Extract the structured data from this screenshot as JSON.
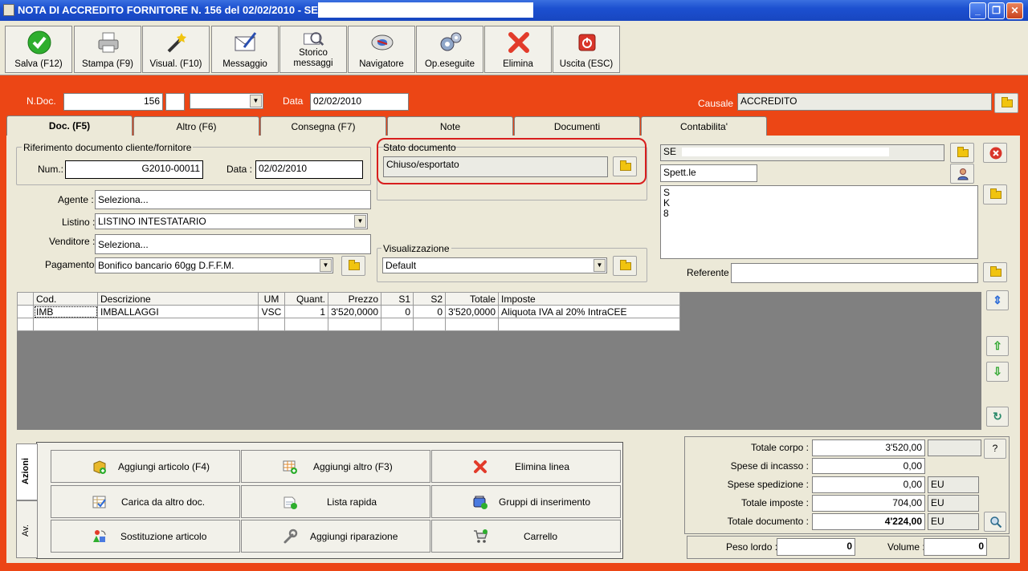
{
  "window": {
    "title": "NOTA DI ACCREDITO FORNITORE N. 156  del 02/02/2010 - SE",
    "minimize": "_",
    "maximize": "❐",
    "close": "✕"
  },
  "toolbar": [
    {
      "label": "Salva (F12)",
      "icon": "check-icon"
    },
    {
      "label": "Stampa (F9)",
      "icon": "printer-icon"
    },
    {
      "label": "Visual. (F10)",
      "icon": "magic-wand-icon"
    },
    {
      "label": "Messaggio",
      "icon": "envelope-pen-icon"
    },
    {
      "label": "Storico messaggi",
      "icon": "mail-history-icon"
    },
    {
      "label": "Navigatore",
      "icon": "navigator-icon"
    },
    {
      "label": "Op.eseguite",
      "icon": "gears-icon"
    },
    {
      "label": "Elimina",
      "icon": "red-x-icon"
    },
    {
      "label": "Uscita (ESC)",
      "icon": "exit-icon"
    }
  ],
  "header": {
    "ndoc_label": "N.Doc.",
    "ndoc_value": "156",
    "data_label": "Data",
    "data_value": "02/02/2010",
    "causale_label": "Causale",
    "causale_value": "ACCREDITO"
  },
  "tabs": [
    "Doc. (F5)",
    "Altro (F6)",
    "Consegna (F7)",
    "Note",
    "Documenti",
    "Contabilita'"
  ],
  "riferimento": {
    "title": "Riferimento documento cliente/fornitore",
    "num_label": "Num.:",
    "num_value": "G2010-00011",
    "data_label": "Data :",
    "data_value": "02/02/2010"
  },
  "stato": {
    "title": "Stato documento",
    "value": "Chiuso/esportato"
  },
  "fields": {
    "agente_label": "Agente :",
    "agente_value": "Seleziona...",
    "listino_label": "Listino :",
    "listino_value": "LISTINO INTESTATARIO",
    "venditore_label": "Venditore :",
    "venditore_value": "Seleziona...",
    "pagamento_label": "Pagamento :",
    "pagamento_value": "Bonifico bancario 60gg D.F.F.M.",
    "visual_title": "Visualizzazione",
    "visual_value": "Default"
  },
  "intestatario": {
    "name": "SE",
    "salutation": "Spett.le",
    "address_lines": [
      "S",
      "K",
      "8"
    ],
    "referente_label": "Referente",
    "referente_value": ""
  },
  "grid": {
    "columns": [
      "Cod.",
      "Descrizione",
      "UM",
      "Quant.",
      "Prezzo",
      "S1",
      "S2",
      "Totale",
      "Imposte"
    ],
    "rows": [
      [
        "IMB",
        "IMBALLAGGI",
        "VSC",
        "1",
        "3'520,0000",
        "0",
        "0",
        "3'520,0000",
        "Aliquota IVA al 20% IntraCEE"
      ]
    ]
  },
  "side_tabs": [
    "Azioni",
    "Av."
  ],
  "actions": [
    {
      "label": "Aggiungi articolo (F4)",
      "icon": "add-box-icon"
    },
    {
      "label": "Aggiungi altro (F3)",
      "icon": "add-grid-icon"
    },
    {
      "label": "Elimina linea",
      "icon": "delete-line-icon"
    },
    {
      "label": "Carica da altro doc.",
      "icon": "load-doc-icon"
    },
    {
      "label": "Lista rapida",
      "icon": "quick-list-icon"
    },
    {
      "label": "Gruppi di inserimento",
      "icon": "group-insert-icon"
    },
    {
      "label": "Sostituzione articolo",
      "icon": "replace-item-icon"
    },
    {
      "label": "Aggiungi riparazione",
      "icon": "wrench-icon"
    },
    {
      "label": "Carrello",
      "icon": "cart-icon"
    }
  ],
  "totals": {
    "corpo_label": "Totale corpo :",
    "corpo_value": "3'520,00",
    "incasso_label": "Spese di incasso :",
    "incasso_value": "0,00",
    "spedizione_label": "Spese spedizione :",
    "spedizione_value": "0,00",
    "spedizione_cur": "EU",
    "imposte_label": "Totale imposte :",
    "imposte_value": "704,00",
    "imposte_cur": "EU",
    "documento_label": "Totale documento :",
    "documento_value": "4'224,00",
    "documento_cur": "EU",
    "help": "?",
    "peso_label": "Peso lordo :",
    "peso_value": "0",
    "volume_label": "Volume :",
    "volume_value": "0"
  },
  "colors": {
    "background": "#ec4615",
    "panel": "#ece9d8",
    "titlebar": "#1c50d0",
    "highlight": "#d81e1e"
  }
}
